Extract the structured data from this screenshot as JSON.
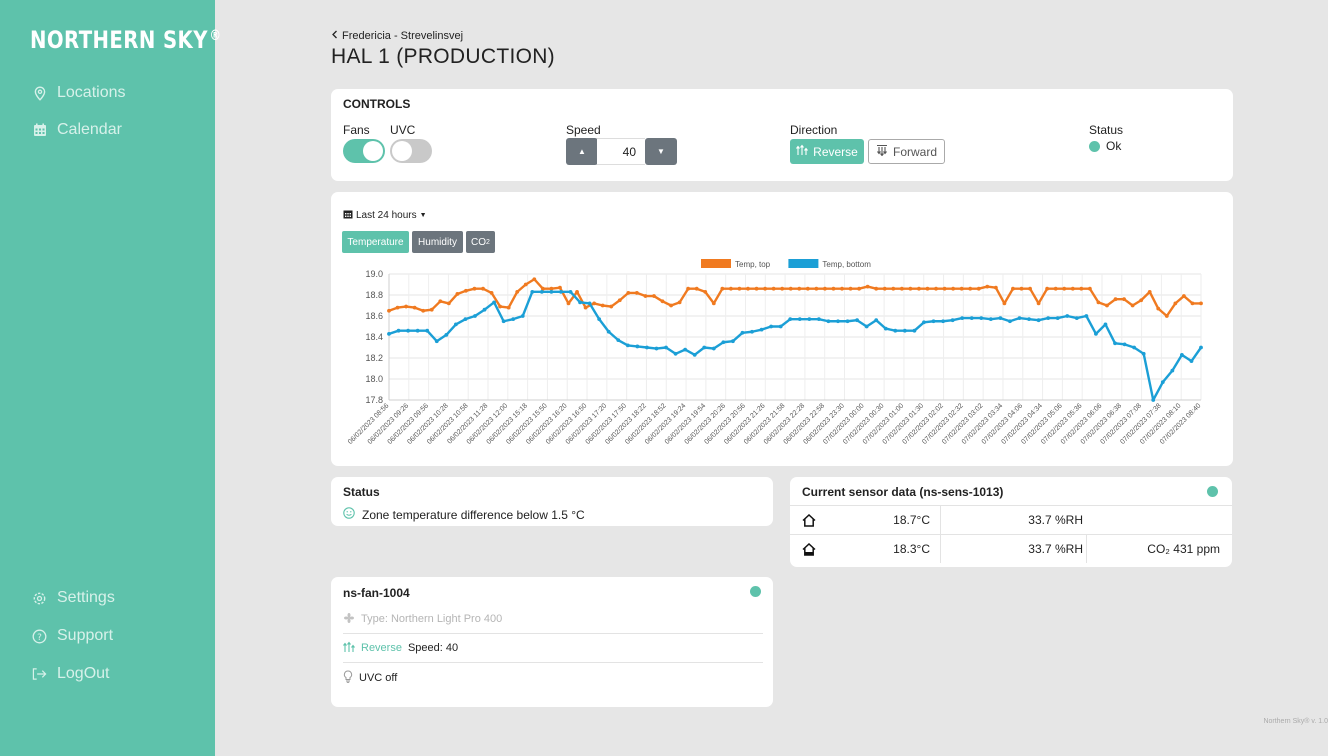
{
  "app": {
    "brand": "NORTHERN SKY",
    "brand_mark": "®",
    "version": "Northern Sky® v. 1.0"
  },
  "sidebar": {
    "items": [
      {
        "label": "Locations",
        "icon": "location-pin-icon"
      },
      {
        "label": "Calendar",
        "icon": "calendar-icon"
      }
    ],
    "bottom_items": [
      {
        "label": "Settings",
        "icon": "gear-icon"
      },
      {
        "label": "Support",
        "icon": "question-icon"
      },
      {
        "label": "LogOut",
        "icon": "logout-icon"
      }
    ]
  },
  "header": {
    "breadcrumb": "Fredericia - Strevelinsvej",
    "title": "HAL 1 (PRODUCTION)"
  },
  "controls": {
    "title": "CONTROLS",
    "fans_label": "Fans",
    "fans_on": true,
    "uvc_label": "UVC",
    "uvc_on": false,
    "speed_label": "Speed",
    "speed_value": "40",
    "direction_label": "Direction",
    "reverse_label": "Reverse",
    "forward_label": "Forward",
    "direction_selected": "Reverse",
    "status_label": "Status",
    "status_value": "Ok"
  },
  "chart_panel": {
    "range_label": "Last 24 hours",
    "tabs": [
      "Temperature",
      "Humidity",
      "CO2"
    ],
    "active_tab": "Temperature"
  },
  "chart_data": {
    "type": "line",
    "title": "",
    "ylim": [
      17.8,
      19.0
    ],
    "y_ticks": [
      "17.8",
      "18.0",
      "18.2",
      "18.4",
      "18.6",
      "18.8",
      "19.0"
    ],
    "grid": true,
    "legend_position": "top-center",
    "x_labels": [
      "06/02/2023 08:56",
      "06/02/2023 09:26",
      "06/02/2023 09:56",
      "06/02/2023 10:28",
      "06/02/2023 10:58",
      "06/02/2023 11:28",
      "06/02/2023 12:00",
      "06/02/2023 15:18",
      "06/02/2023 15:50",
      "06/02/2023 16:20",
      "06/02/2023 16:50",
      "06/02/2023 17:20",
      "06/02/2023 17:50",
      "06/02/2023 18:22",
      "06/02/2023 18:52",
      "06/02/2023 19:24",
      "06/02/2023 19:54",
      "06/02/2023 20:26",
      "06/02/2023 20:56",
      "06/02/2023 21:26",
      "06/02/2023 21:58",
      "06/02/2023 22:28",
      "06/02/2023 22:58",
      "06/02/2023 23:30",
      "07/02/2023 00:00",
      "07/02/2023 00:30",
      "07/02/2023 01:00",
      "07/02/2023 01:30",
      "07/02/2023 02:02",
      "07/02/2023 02:32",
      "07/02/2023 03:02",
      "07/02/2023 03:34",
      "07/02/2023 04:06",
      "07/02/2023 04:34",
      "07/02/2023 05:06",
      "07/02/2023 05:36",
      "07/02/2023 06:06",
      "07/02/2023 06:38",
      "07/02/2023 07:08",
      "07/02/2023 07:38",
      "07/02/2023 08:10",
      "07/02/2023 08:40"
    ],
    "series": [
      {
        "name": "Temp, top",
        "color": "#f07a20",
        "values": [
          18.65,
          18.68,
          18.69,
          18.68,
          18.65,
          18.66,
          18.74,
          18.72,
          18.81,
          18.84,
          18.86,
          18.86,
          18.82,
          18.69,
          18.68,
          18.83,
          18.9,
          18.95,
          18.86,
          18.86,
          18.87,
          18.72,
          18.83,
          18.68,
          18.72,
          18.7,
          18.69,
          18.75,
          18.82,
          18.82,
          18.79,
          18.79,
          18.74,
          18.7,
          18.73,
          18.86,
          18.86,
          18.83,
          18.72,
          18.86,
          18.86,
          18.86,
          18.86,
          18.86,
          18.86,
          18.86,
          18.86,
          18.86,
          18.86,
          18.86,
          18.86,
          18.86,
          18.86,
          18.86,
          18.86,
          18.86,
          18.88,
          18.86,
          18.86,
          18.86,
          18.86,
          18.86,
          18.86,
          18.86,
          18.86,
          18.86,
          18.86,
          18.86,
          18.86,
          18.86,
          18.88,
          18.87,
          18.72,
          18.86,
          18.86,
          18.86,
          18.72,
          18.86,
          18.86,
          18.86,
          18.86,
          18.86,
          18.86,
          18.73,
          18.7,
          18.76,
          18.76,
          18.7,
          18.75,
          18.83,
          18.67,
          18.6,
          18.72,
          18.79,
          18.72,
          18.72
        ]
      },
      {
        "name": "Temp, bottom",
        "color": "#1b9fd6",
        "values": [
          18.43,
          18.46,
          18.46,
          18.46,
          18.46,
          18.36,
          18.42,
          18.52,
          18.57,
          18.6,
          18.66,
          18.73,
          18.55,
          18.57,
          18.6,
          18.83,
          18.83,
          18.83,
          18.83,
          18.83,
          18.73,
          18.72,
          18.57,
          18.45,
          18.37,
          18.32,
          18.31,
          18.3,
          18.29,
          18.3,
          18.24,
          18.28,
          18.23,
          18.3,
          18.29,
          18.35,
          18.36,
          18.44,
          18.45,
          18.47,
          18.5,
          18.5,
          18.57,
          18.57,
          18.57,
          18.57,
          18.55,
          18.55,
          18.55,
          18.56,
          18.5,
          18.56,
          18.48,
          18.46,
          18.46,
          18.46,
          18.54,
          18.55,
          18.55,
          18.56,
          18.58,
          18.58,
          18.58,
          18.57,
          18.58,
          18.55,
          18.58,
          18.57,
          18.56,
          18.58,
          18.58,
          18.6,
          18.58,
          18.6,
          18.43,
          18.52,
          18.34,
          18.33,
          18.3,
          18.24,
          17.8,
          17.97,
          18.08,
          18.23,
          18.17,
          18.3
        ]
      }
    ]
  },
  "status_panel": {
    "title": "Status",
    "message": "Zone temperature difference below 1.5 °C"
  },
  "sensor_panel": {
    "title": "Current sensor data (ns-sens-1013)",
    "rows": [
      {
        "icon": "house-top-icon",
        "temp": "18.7°C",
        "hum": "33.7 %RH",
        "co2": ""
      },
      {
        "icon": "house-bottom-icon",
        "temp": "18.3°C",
        "hum": "33.7 %RH",
        "co2": "CO₂ 431 ppm"
      }
    ]
  },
  "fan_panel": {
    "title": "ns-fan-1004",
    "type_line": "Type: Northern Light Pro 400",
    "direction_text": "Reverse",
    "speed_text": "Speed: 40",
    "uvc_text": "UVC off"
  },
  "colors": {
    "accent": "#5ec2ab",
    "secondary": "#6c757d",
    "background": "#e6e6e6"
  }
}
